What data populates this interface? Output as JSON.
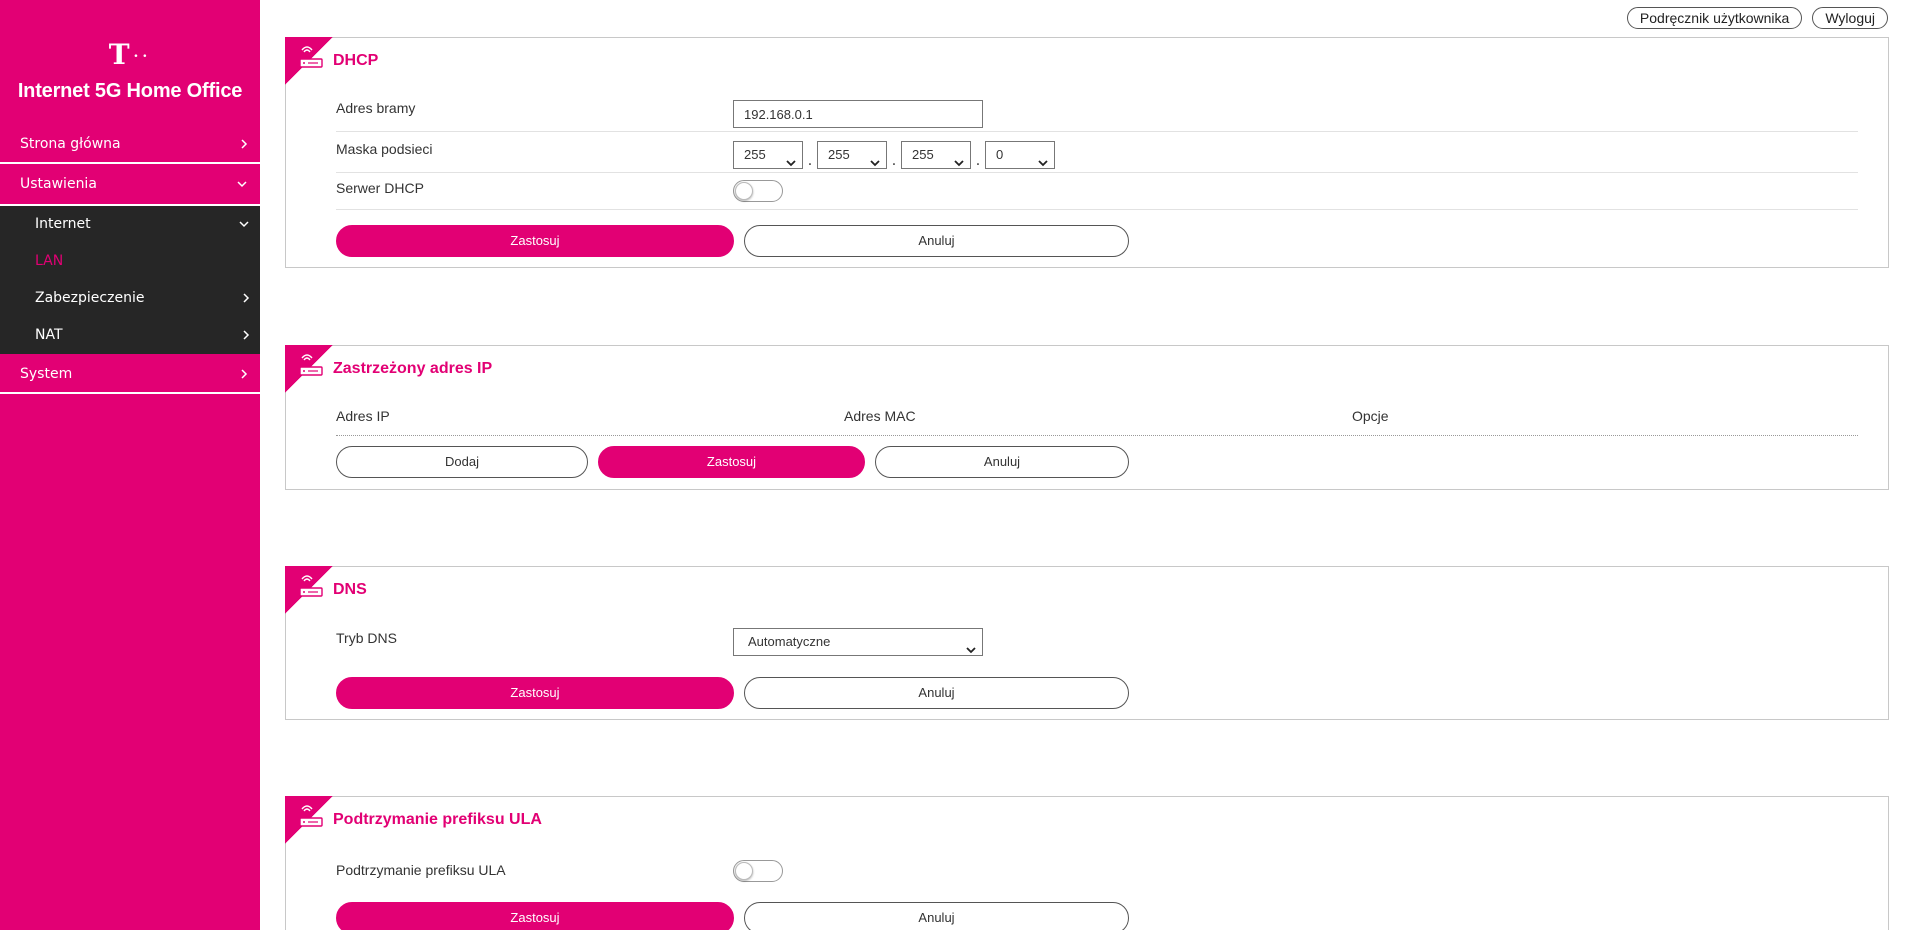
{
  "sidebar": {
    "logo_text": "T",
    "app_title": "Internet 5G Home Office",
    "items": [
      {
        "label": "Strona główna"
      },
      {
        "label": "Ustawienia"
      },
      {
        "label": "System"
      }
    ],
    "subitems": [
      {
        "label": "Internet"
      },
      {
        "label": "LAN"
      },
      {
        "label": "Zabezpieczenie"
      },
      {
        "label": "NAT"
      }
    ]
  },
  "header": {
    "manual_label": "Podręcznik użytkownika",
    "logout_label": "Wyloguj"
  },
  "dhcp": {
    "title": "DHCP",
    "gateway_label": "Adres bramy",
    "gateway_value": "192.168.0.1",
    "mask_label": "Maska podsieci",
    "mask_values": [
      "255",
      "255",
      "255",
      "0"
    ],
    "mask_separator": ".",
    "server_label": "Serwer DHCP",
    "apply_label": "Zastosuj",
    "cancel_label": "Anuluj"
  },
  "reserved_ip": {
    "title": "Zastrzeżony adres IP",
    "columns": [
      "Adres IP",
      "Adres MAC",
      "Opcje"
    ],
    "add_label": "Dodaj",
    "apply_label": "Zastosuj",
    "cancel_label": "Anuluj"
  },
  "dns": {
    "title": "DNS",
    "mode_label": "Tryb DNS",
    "mode_value": "Automatyczne",
    "apply_label": "Zastosuj",
    "cancel_label": "Anuluj"
  },
  "ula": {
    "title": "Podtrzymanie prefiksu ULA",
    "toggle_label": "Podtrzymanie prefiksu ULA",
    "apply_label": "Zastosuj",
    "cancel_label": "Anuluj"
  },
  "colors": {
    "brand": "#e20074",
    "submenu_bg": "#262626"
  }
}
